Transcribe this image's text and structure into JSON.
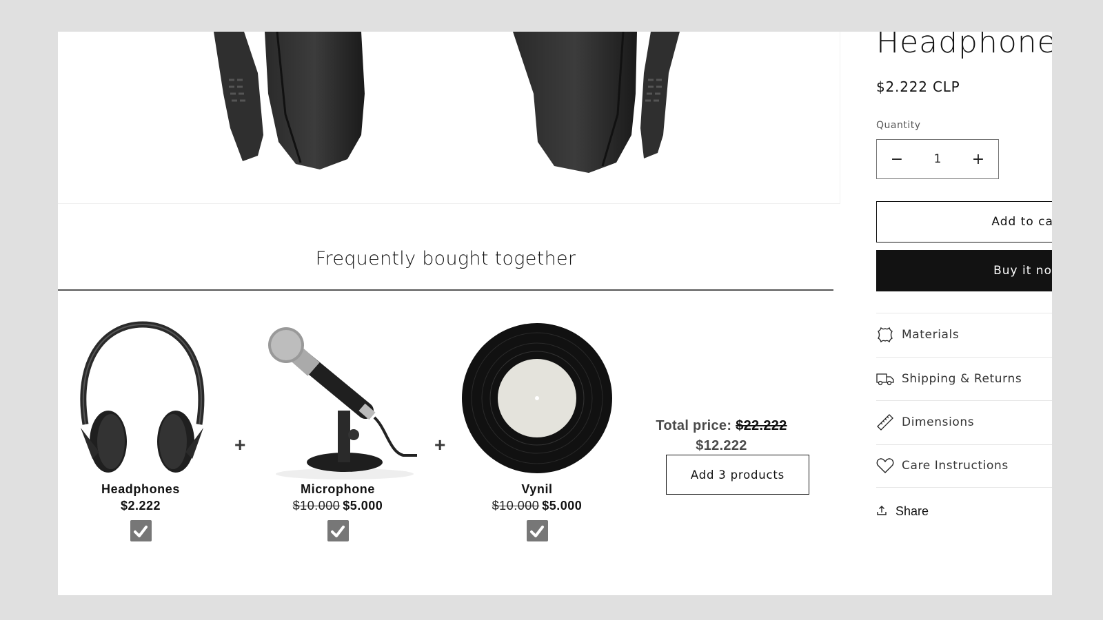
{
  "product": {
    "title": "Headphones",
    "price": "$2.222 CLP",
    "quantity_label": "Quantity",
    "quantity_value": "1",
    "decrease_symbol": "−",
    "increase_symbol": "+",
    "add_to_cart_label": "Add to cart",
    "buy_now_label": "Buy it now"
  },
  "accordion": [
    {
      "icon": "leather-icon",
      "label": "Materials"
    },
    {
      "icon": "truck-icon",
      "label": "Shipping & Returns"
    },
    {
      "icon": "ruler-icon",
      "label": "Dimensions"
    },
    {
      "icon": "heart-icon",
      "label": "Care Instructions"
    }
  ],
  "share": {
    "icon": "share-icon",
    "label": "Share"
  },
  "fbt": {
    "title": "Frequently bought together",
    "plus_symbol": "+",
    "items": [
      {
        "name": "Headphones",
        "old_price": "",
        "price": "$2.222",
        "checked": true
      },
      {
        "name": "Microphone",
        "old_price": "$10.000",
        "price": "$5.000",
        "checked": true
      },
      {
        "name": "Vynil",
        "old_price": "$10.000",
        "price": "$5.000",
        "checked": true
      }
    ],
    "total_label": "Total price:",
    "total_old": "$22.222",
    "total_new": "$12.222",
    "add_all_label": "Add 3 products"
  }
}
